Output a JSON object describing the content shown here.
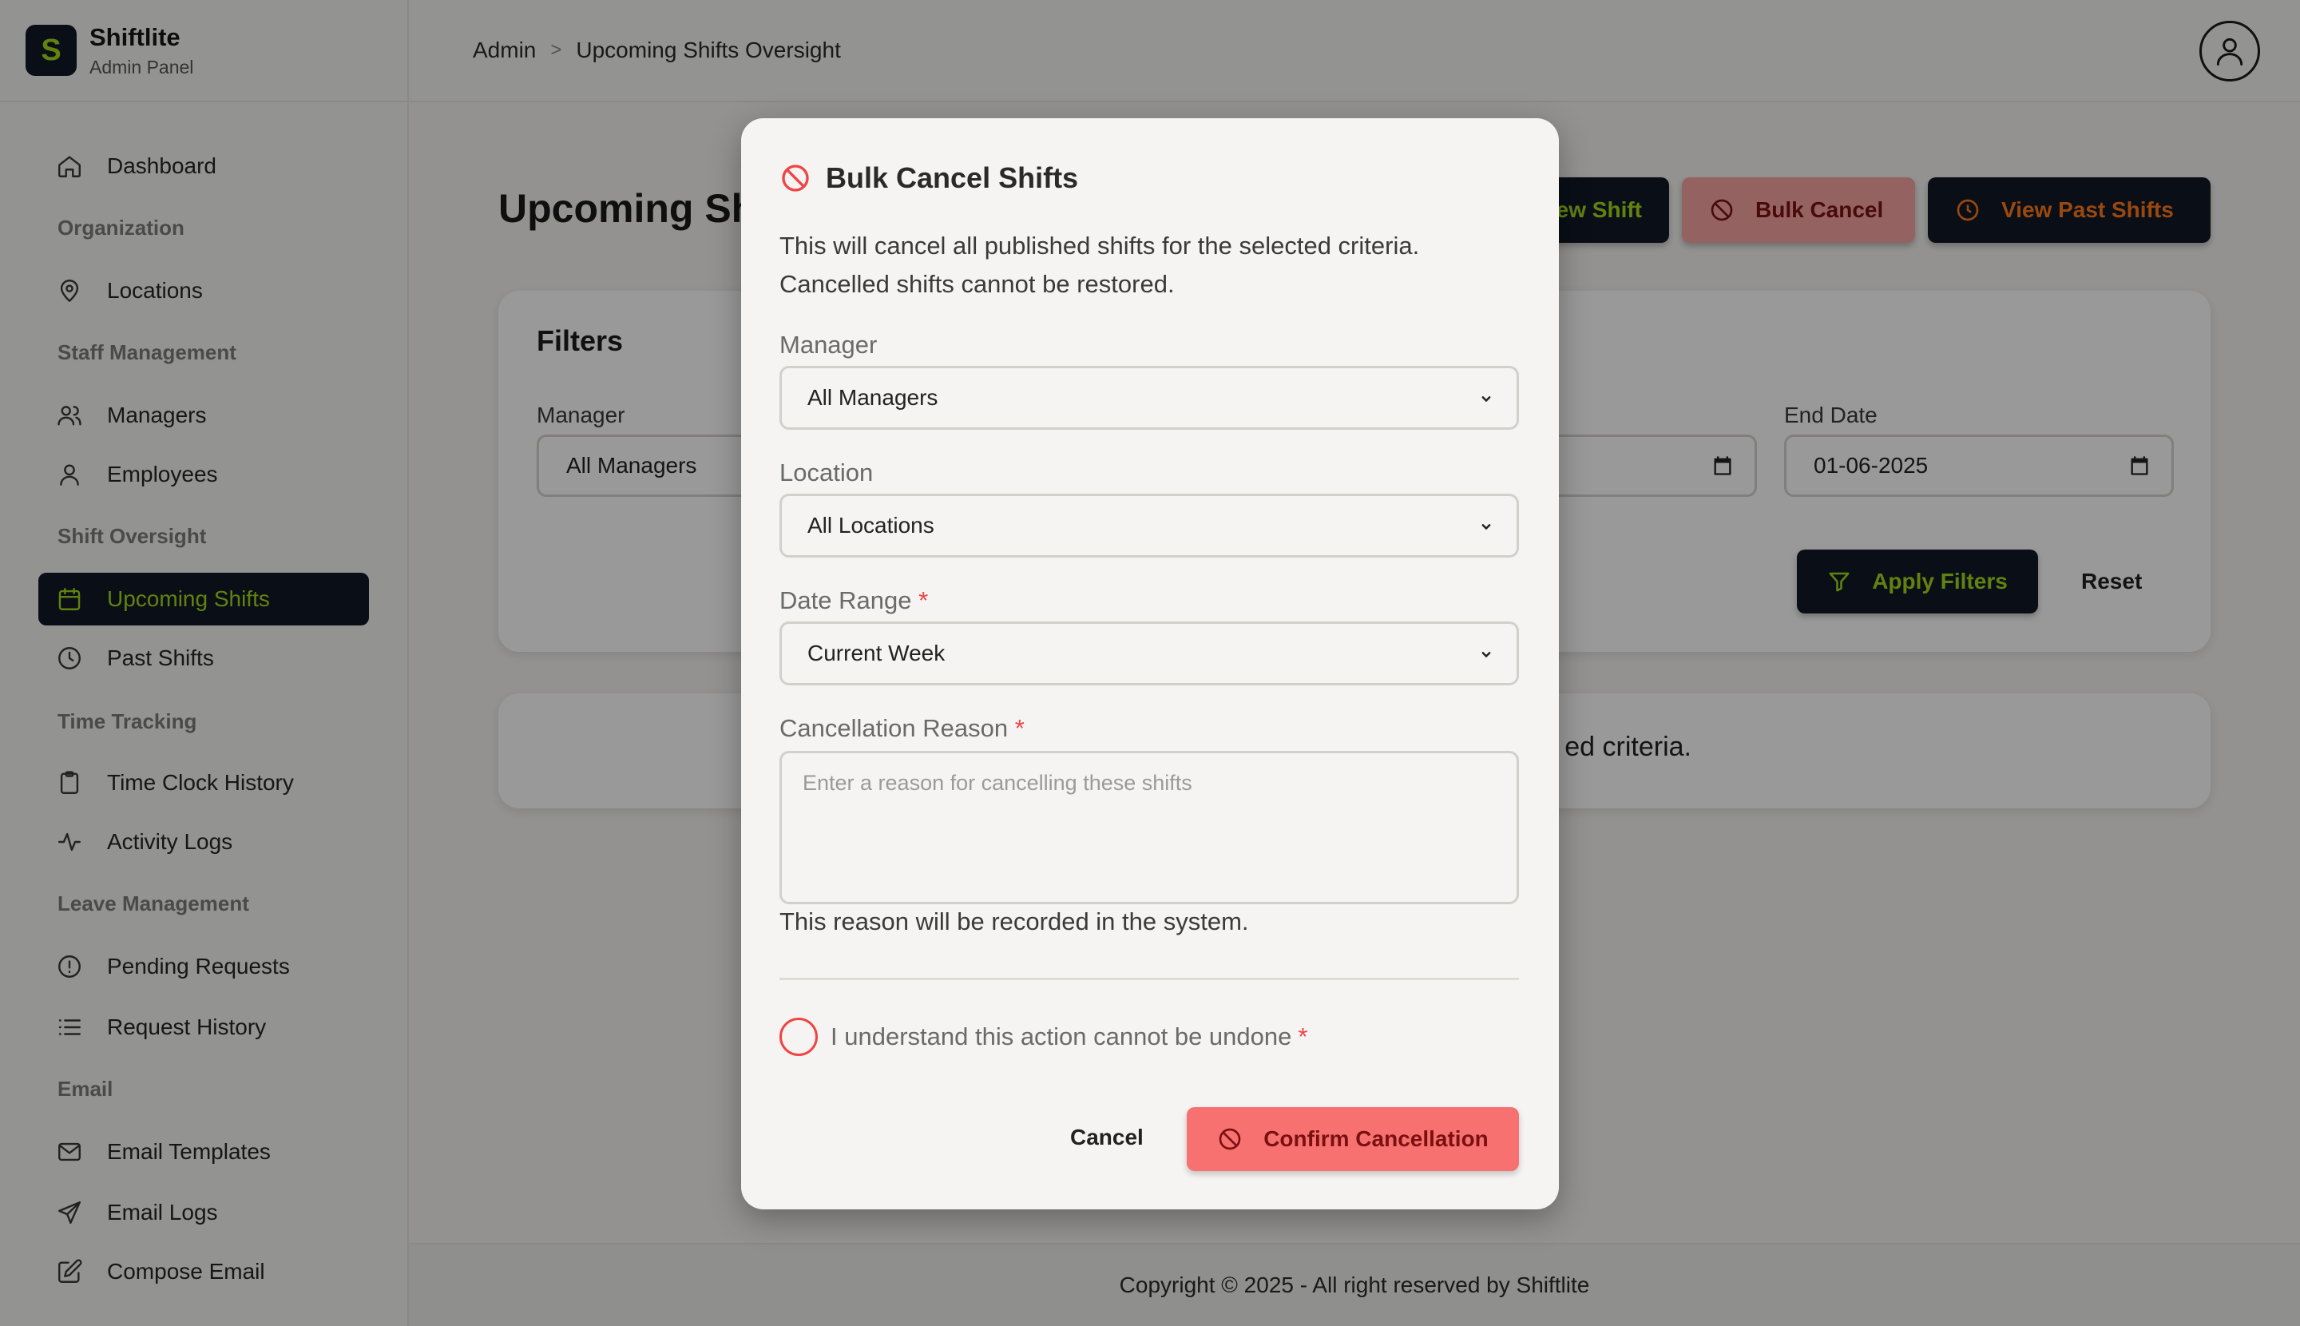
{
  "brand": {
    "logo_letter": "S",
    "name": "Shiftlite",
    "subtitle": "Admin Panel"
  },
  "sidebar": {
    "items": [
      {
        "type": "item",
        "label": "Dashboard",
        "icon": "home-icon"
      },
      {
        "type": "section",
        "label": "Organization"
      },
      {
        "type": "item",
        "label": "Locations",
        "icon": "map-pin-icon"
      },
      {
        "type": "section",
        "label": "Staff Management"
      },
      {
        "type": "item",
        "label": "Managers",
        "icon": "users-icon"
      },
      {
        "type": "item",
        "label": "Employees",
        "icon": "user-icon"
      },
      {
        "type": "section",
        "label": "Shift Oversight"
      },
      {
        "type": "item",
        "label": "Upcoming Shifts",
        "icon": "calendar-icon",
        "active": true
      },
      {
        "type": "item",
        "label": "Past Shifts",
        "icon": "clock-icon"
      },
      {
        "type": "section",
        "label": "Time Tracking"
      },
      {
        "type": "item",
        "label": "Time Clock History",
        "icon": "clipboard-icon"
      },
      {
        "type": "item",
        "label": "Activity Logs",
        "icon": "activity-icon"
      },
      {
        "type": "section",
        "label": "Leave Management"
      },
      {
        "type": "item",
        "label": "Pending Requests",
        "icon": "alert-circle-icon"
      },
      {
        "type": "item",
        "label": "Request History",
        "icon": "list-icon"
      },
      {
        "type": "section",
        "label": "Email"
      },
      {
        "type": "item",
        "label": "Email Templates",
        "icon": "mail-icon"
      },
      {
        "type": "item",
        "label": "Email Logs",
        "icon": "send-icon"
      },
      {
        "type": "item",
        "label": "Compose Email",
        "icon": "edit-icon"
      }
    ]
  },
  "header": {
    "breadcrumbs": [
      "Admin",
      "Upcoming Shifts Oversight"
    ],
    "breadcrumb_separator": ">"
  },
  "main": {
    "title": "Upcoming Sh",
    "buttons": {
      "new_shift": "ew Shift",
      "bulk_cancel": "Bulk Cancel",
      "view_past": "View Past Shifts"
    },
    "filters": {
      "title": "Filters",
      "manager_label": "Manager",
      "manager_value": "All Managers",
      "end_date_label": "End Date",
      "end_date_value": "01-06-2025",
      "apply_label": "Apply Filters",
      "reset_label": "Reset"
    },
    "empty_message": "ed criteria."
  },
  "footer": {
    "text": "Copyright © 2025 - All right reserved by Shiftlite"
  },
  "modal": {
    "title": "Bulk Cancel Shifts",
    "description": "This will cancel all published shifts for the selected criteria. Cancelled shifts cannot be restored.",
    "manager_label": "Manager",
    "manager_value": "All Managers",
    "location_label": "Location",
    "location_value": "All Locations",
    "date_range_label": "Date Range",
    "date_range_value": "Current Week",
    "reason_label": "Cancellation Reason",
    "reason_placeholder": "Enter a reason for cancelling these shifts",
    "reason_help": "This reason will be recorded in the system.",
    "acknowledge_label": "I understand this action cannot be undone",
    "required_mark": "*",
    "cancel_label": "Cancel",
    "confirm_label": "Confirm Cancellation"
  },
  "colors": {
    "brand_dark": "#121826",
    "accent_lime": "#a3d91c",
    "accent_orange": "#ff7a1a",
    "danger": "#f87171",
    "required": "#ef4444"
  }
}
